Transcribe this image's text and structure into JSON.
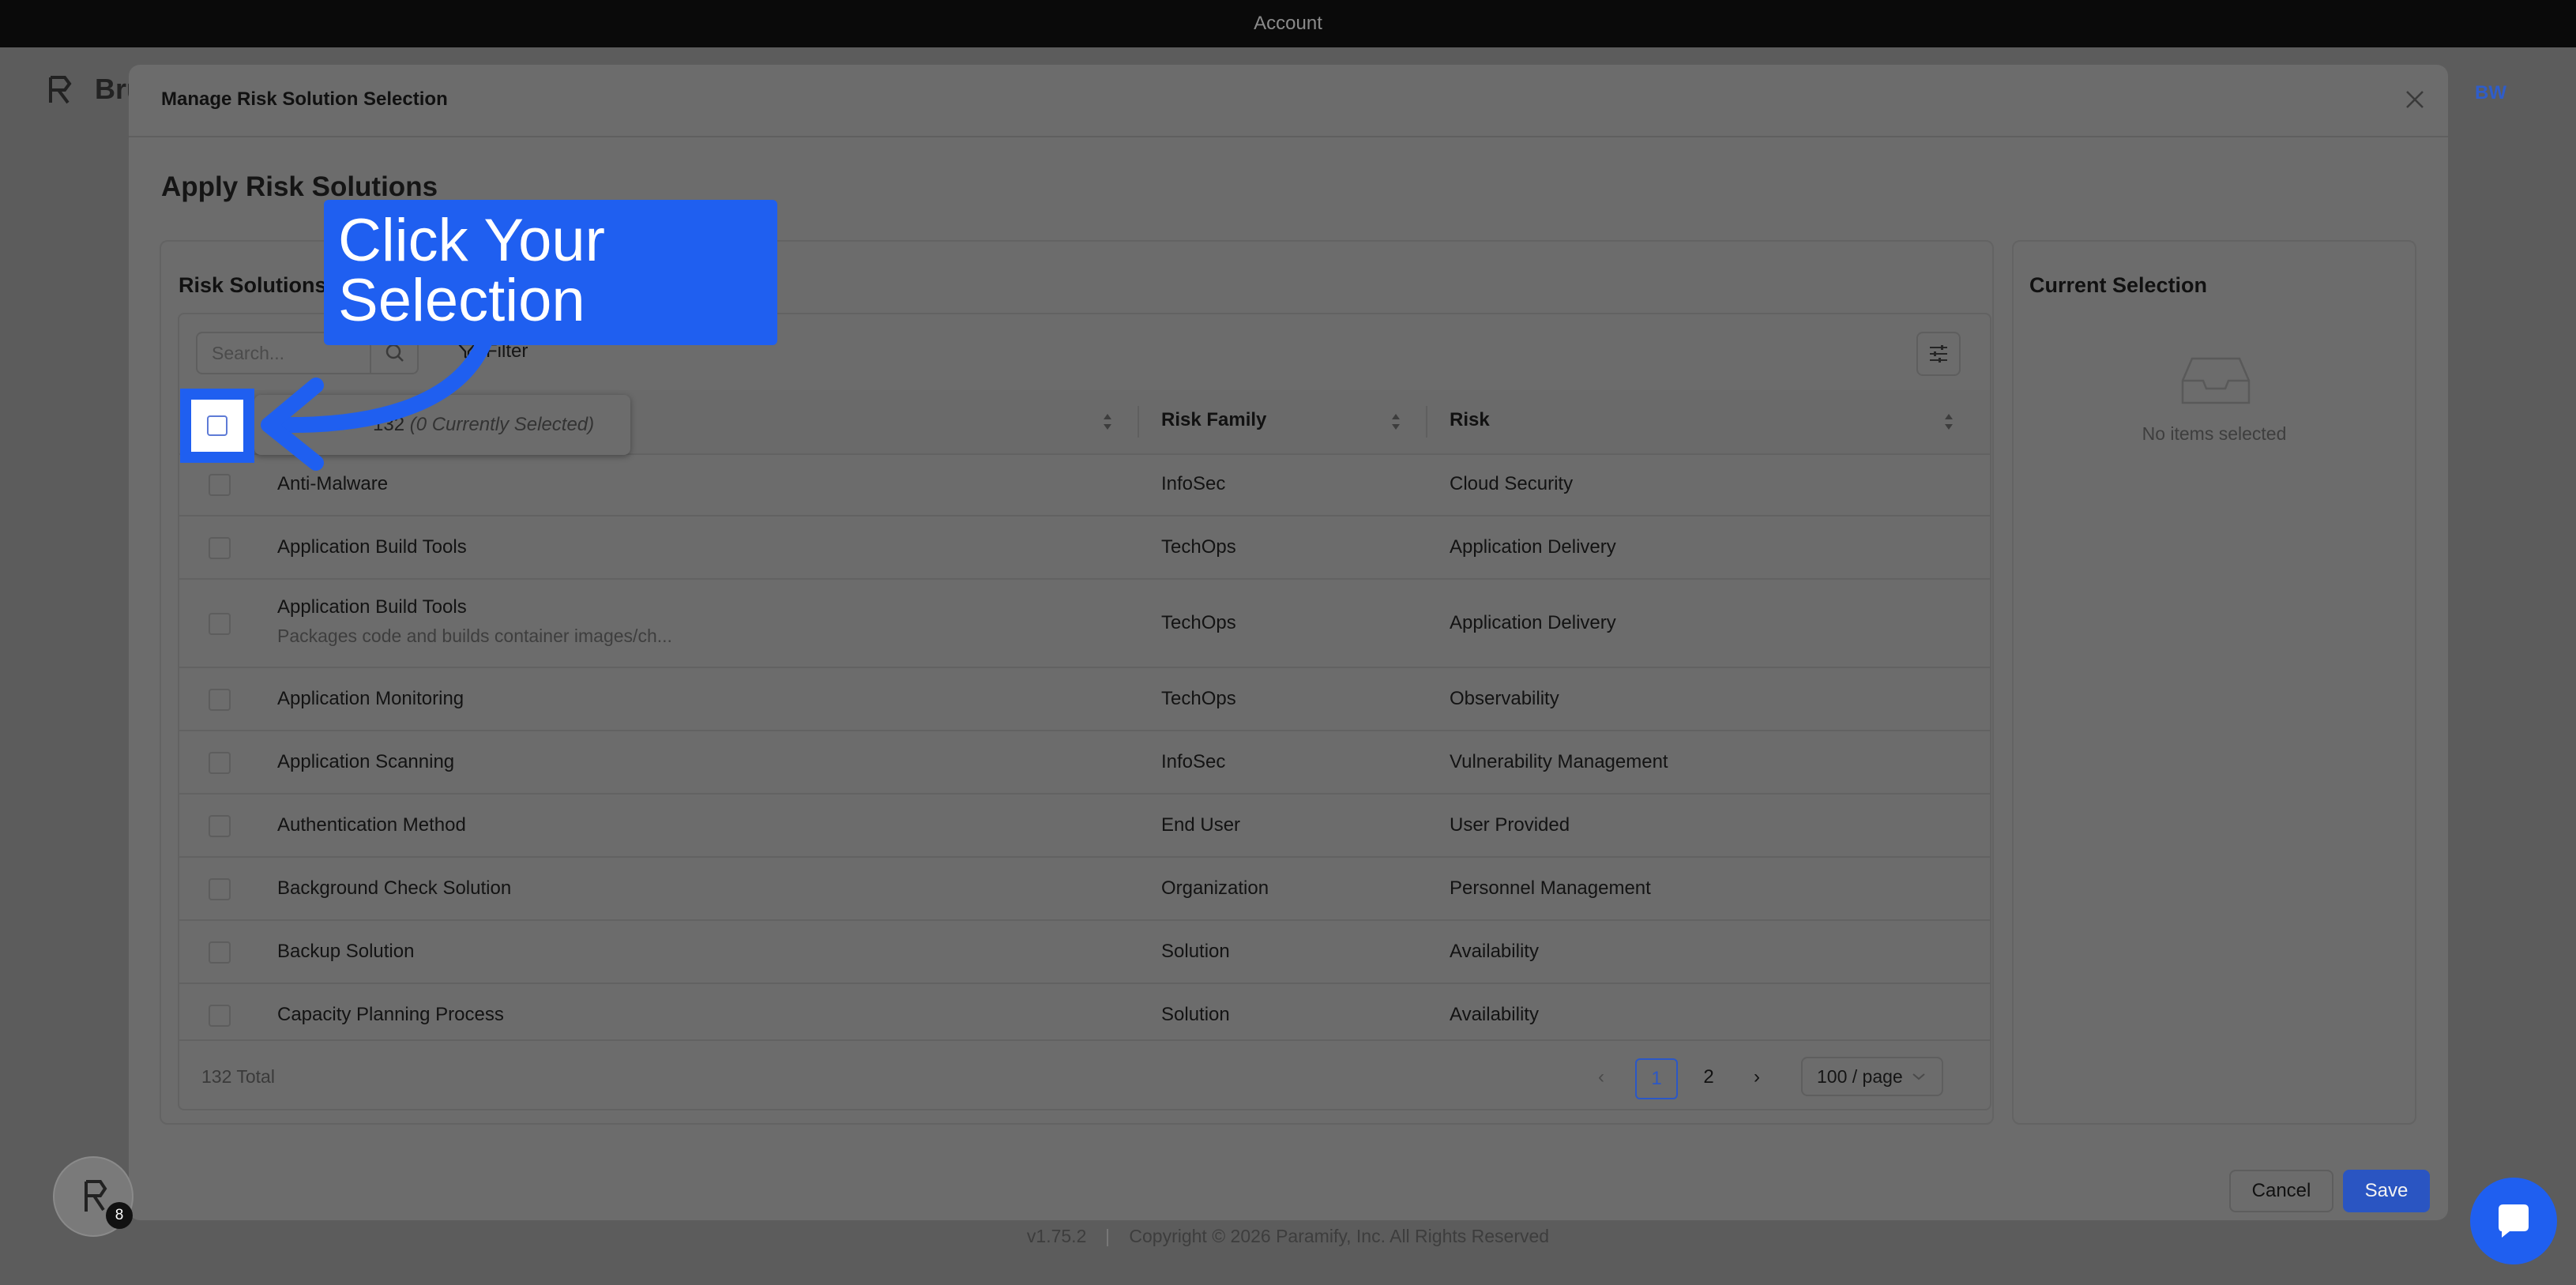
{
  "window": {
    "title": "Account"
  },
  "app": {
    "brand": "Bru",
    "user_initials": "BW"
  },
  "modal": {
    "title": "Manage Risk Solution Selection",
    "heading": "Apply Risk Solutions",
    "left_panel_title": "Risk Solutions",
    "search_placeholder": "Search...",
    "filter_label": "Filter",
    "columns": {
      "risk_family": "Risk Family",
      "risk": "Risk"
    },
    "selection_summary_count": "132",
    "selection_summary_note": "(0 Currently Selected)",
    "rows": [
      {
        "name": "Anti-Malware",
        "family": "InfoSec",
        "risk": "Cloud Security"
      },
      {
        "name": "Application Build Tools",
        "family": "TechOps",
        "risk": "Application Delivery"
      },
      {
        "name": "Application Build Tools",
        "desc": "Packages code and builds container images/ch...",
        "family": "TechOps",
        "risk": "Application Delivery"
      },
      {
        "name": "Application Monitoring",
        "family": "TechOps",
        "risk": "Observability"
      },
      {
        "name": "Application Scanning",
        "family": "InfoSec",
        "risk": "Vulnerability Management"
      },
      {
        "name": "Authentication Method",
        "family": "End User",
        "risk": "User Provided"
      },
      {
        "name": "Background Check Solution",
        "family": "Organization",
        "risk": "Personnel Management"
      },
      {
        "name": "Backup Solution",
        "family": "Solution",
        "risk": "Availability"
      },
      {
        "name": "Capacity Planning Process",
        "family": "Solution",
        "risk": "Availability"
      }
    ],
    "total_label": "132 Total",
    "pagination": {
      "prev": "‹",
      "page1": "1",
      "page2": "2",
      "next": "›",
      "page_size": "100 / page",
      "current_page": 1
    },
    "right_panel_title": "Current Selection",
    "empty_text": "No items selected",
    "cancel_label": "Cancel",
    "save_label": "Save"
  },
  "tutorial": {
    "callout_line1": "Click Your",
    "callout_line2": "Selection"
  },
  "footer": {
    "version": "v1.75.2",
    "copyright": "Copyright © 2026 Paramify, Inc. All Rights Reserved"
  },
  "widgets": {
    "fab_badge": "8"
  },
  "colors": {
    "accent": "#1f5ff0",
    "primary_button": "#2a55c2"
  }
}
